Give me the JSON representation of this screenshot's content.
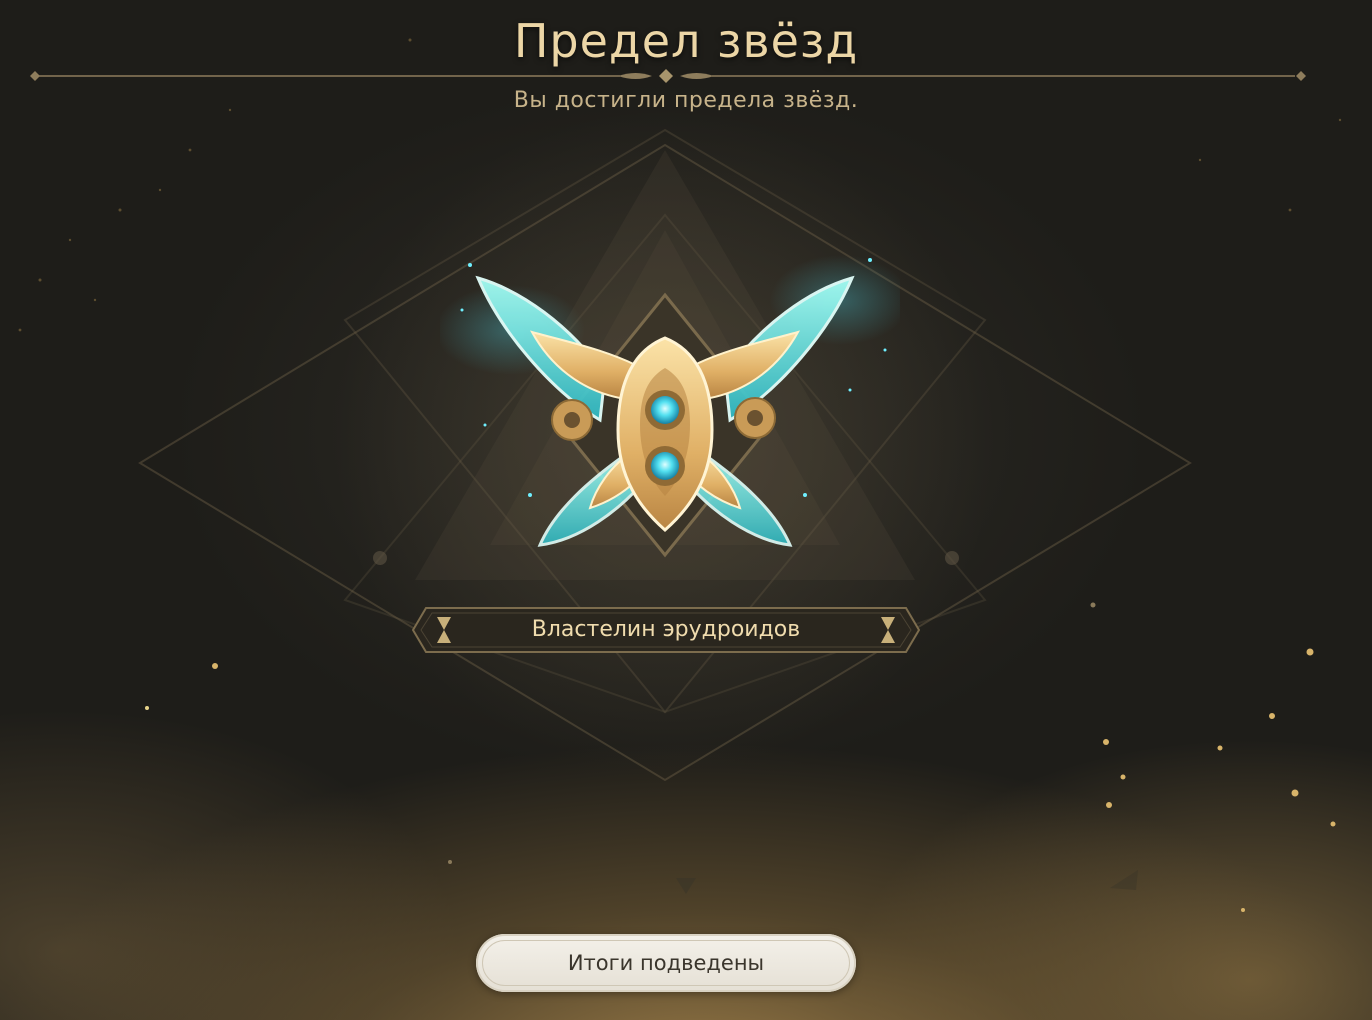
{
  "header": {
    "title": "Предел звёзд",
    "subtitle": "Вы достигли предела звёзд."
  },
  "achievement": {
    "name": "Властелин эрудроидов",
    "icon": "butterfly-gear-emblem-icon"
  },
  "actions": {
    "confirm_label": "Итоги подведены"
  },
  "colors": {
    "gold_text": "#ecd6a6",
    "wing_cyan": "#6fe9e4",
    "emblem_gold": "#e2b66c",
    "button_bg": "#f1eee7"
  }
}
